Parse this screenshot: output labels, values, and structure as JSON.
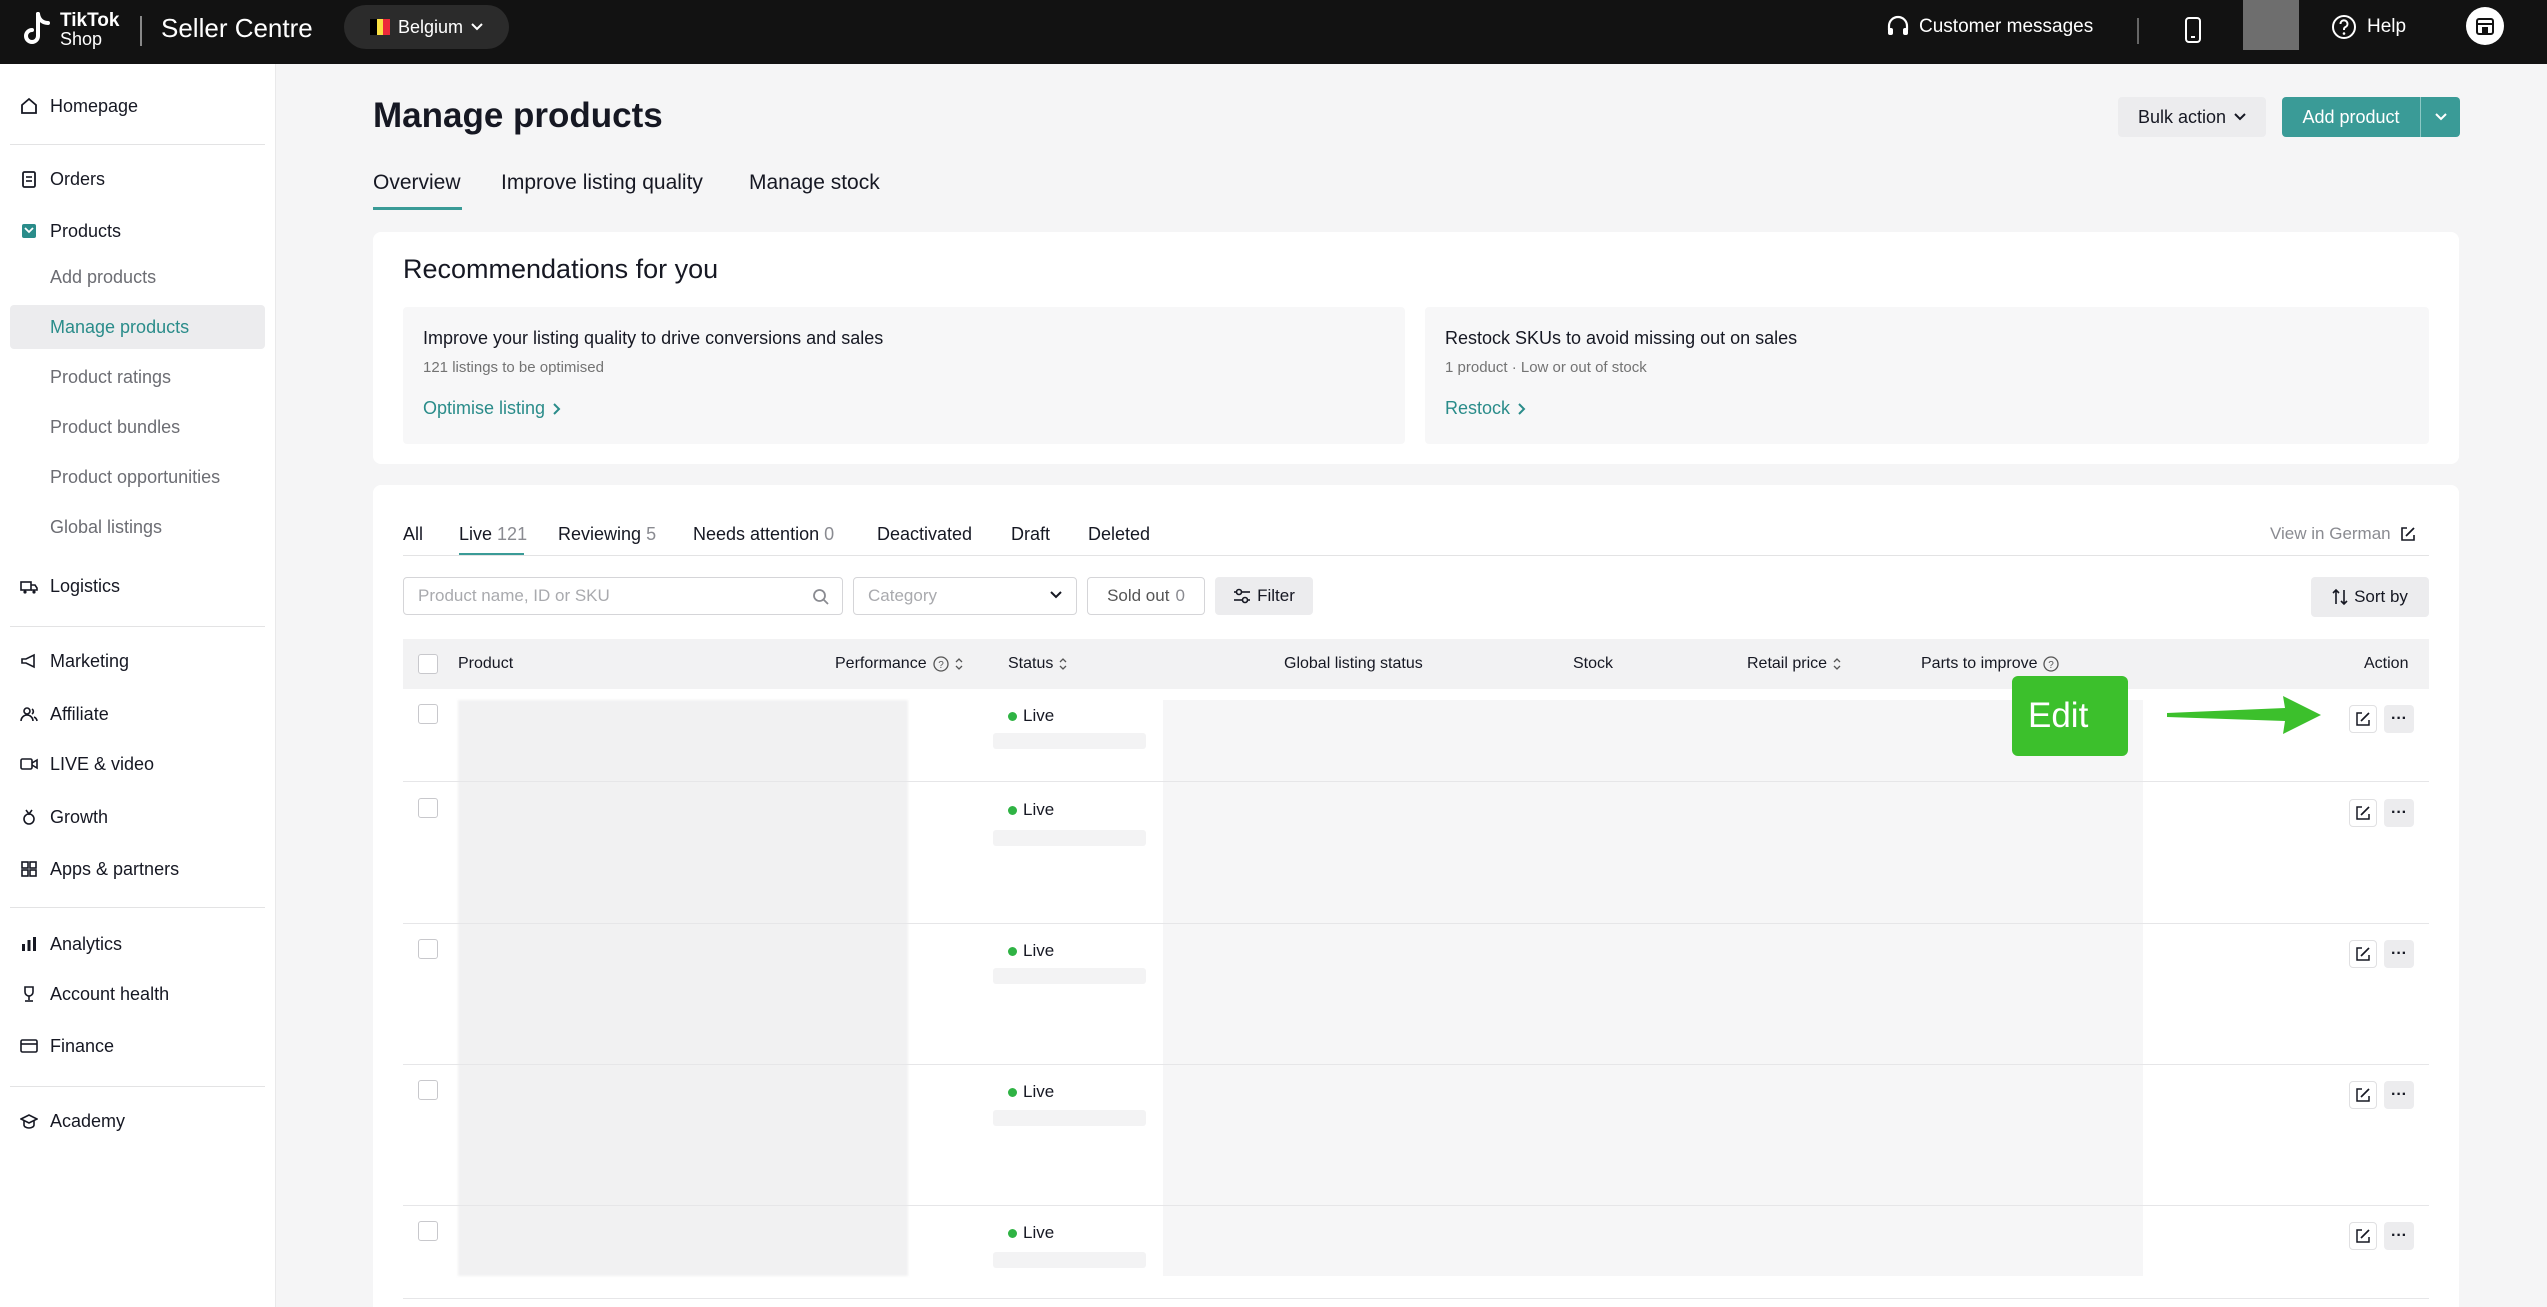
{
  "topbar": {
    "logo_text": "TikTok Shop",
    "logo_line1": "TikTok",
    "logo_line2": "Shop",
    "app_title": "Seller Centre",
    "region": "Belgium",
    "customer_messages": "Customer messages",
    "help": "Help"
  },
  "sidebar": {
    "homepage": "Homepage",
    "orders": "Orders",
    "products": "Products",
    "products_sub": [
      "Add products",
      "Manage products",
      "Product ratings",
      "Product bundles",
      "Product opportunities",
      "Global listings"
    ],
    "logistics": "Logistics",
    "marketing": "Marketing",
    "affiliate": "Affiliate",
    "live_video": "LIVE & video",
    "growth": "Growth",
    "apps_partners": "Apps & partners",
    "analytics": "Analytics",
    "account_health": "Account health",
    "finance": "Finance",
    "academy": "Academy"
  },
  "page": {
    "title": "Manage products",
    "bulk_action": "Bulk action",
    "add_product": "Add product",
    "tabs": [
      "Overview",
      "Improve listing quality",
      "Manage stock"
    ]
  },
  "recommendations": {
    "title": "Recommendations for you",
    "cards": [
      {
        "heading": "Improve your listing quality to drive conversions and sales",
        "sub": "121 listings to be optimised",
        "link": "Optimise listing"
      },
      {
        "heading": "Restock SKUs to avoid missing out on sales",
        "sub": "1 product · Low or out of stock",
        "link": "Restock"
      }
    ]
  },
  "filters": {
    "tabs": [
      {
        "label": "All",
        "count": ""
      },
      {
        "label": "Live",
        "count": "121"
      },
      {
        "label": "Reviewing",
        "count": "5"
      },
      {
        "label": "Needs attention",
        "count": "0"
      },
      {
        "label": "Deactivated",
        "count": ""
      },
      {
        "label": "Draft",
        "count": ""
      },
      {
        "label": "Deleted",
        "count": ""
      }
    ],
    "view_in_german": "View in German",
    "search_placeholder": "Product name, ID or SKU",
    "category_placeholder": "Category",
    "sold_out": "Sold out",
    "sold_out_count": "0",
    "filter": "Filter",
    "sort_by": "Sort by"
  },
  "table": {
    "columns": [
      "Product",
      "Performance",
      "Status",
      "Global listing status",
      "Stock",
      "Retail price",
      "Parts to improve",
      "Action"
    ],
    "rows": [
      {
        "status": "Live"
      },
      {
        "status": "Live"
      },
      {
        "status": "Live"
      },
      {
        "status": "Live"
      },
      {
        "status": "Live"
      }
    ]
  },
  "annotation": {
    "label": "Edit",
    "color": "#3cc02c"
  },
  "colors": {
    "accent": "#3a9b97",
    "topbar": "#121212",
    "live_dot": "#2fb344"
  }
}
